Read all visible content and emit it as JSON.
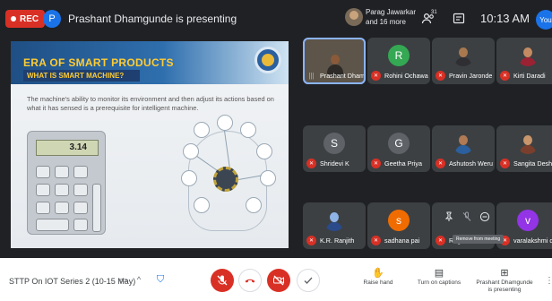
{
  "topbar": {
    "rec_label": "REC",
    "presenter_initial": "P",
    "presenting_text": "Prashant Dhamgunde is presenting",
    "participants_line1": "Parag Jawarkar",
    "participants_line2": "and 16 more",
    "people_count": "31",
    "time": "10:13 AM",
    "you_label": "You"
  },
  "slide": {
    "title": "ERA OF SMART PRODUCTS",
    "subtitle": "WHAT IS SMART MACHINE?",
    "body": "The machine's ability to monitor its environment and then adjust its actions based on what it has sensed is a prerequisite for intelligent machine.",
    "calculator_display": "3.14"
  },
  "tiles": [
    {
      "name": "Prashant Dham...",
      "kind": "video",
      "speaking": true
    },
    {
      "name": "Rohini Ochawar",
      "kind": "initial",
      "initial": "R",
      "color": "#34a853"
    },
    {
      "name": "Pravin Jaronde",
      "kind": "photo",
      "face": "#a8784f",
      "body": "#2f2f33"
    },
    {
      "name": "Kirti Daradi",
      "kind": "photo",
      "face": "#c48b62",
      "body": "#9b2233"
    },
    {
      "name": "Shridevi K",
      "kind": "initial",
      "initial": "S",
      "color": "#5f6368"
    },
    {
      "name": "Geetha Priya",
      "kind": "initial",
      "initial": "G",
      "color": "#5f6368"
    },
    {
      "name": "Ashutosh Weru...",
      "kind": "photo",
      "face": "#b07a55",
      "body": "#2b5f9e"
    },
    {
      "name": "Sangita Deshm...",
      "kind": "photo",
      "face": "#c9956b",
      "body": "#7a3f2c"
    },
    {
      "name": "K.R. Ranjith",
      "kind": "photo",
      "face": "#8fb4e8",
      "body": "#2a4a8a"
    },
    {
      "name": "sadhana pai",
      "kind": "initial",
      "initial": "s",
      "color": "#f06c00"
    },
    {
      "name": "Rag",
      "kind": "hover"
    },
    {
      "name": "varalakshmi da...",
      "kind": "initial",
      "initial": "v",
      "color": "#9334e6"
    }
  ],
  "hover": {
    "tooltip": "Remove from meeting",
    "icons": [
      "pin-icon",
      "mic-off-icon",
      "remove-icon"
    ]
  },
  "bottombar": {
    "meeting_title": "STTP On IOT Series 2 (10-15 May)",
    "actions": {
      "raise_hand": "Raise hand",
      "captions": "Turn on captions",
      "presenting_line1": "Prashant Dhamgunde",
      "presenting_line2": "is presenting"
    }
  },
  "colors": {
    "rec": "#d93025",
    "accent": "#1a73e8",
    "muted_red": "#d93025",
    "slide_title": "#ffcc33"
  }
}
